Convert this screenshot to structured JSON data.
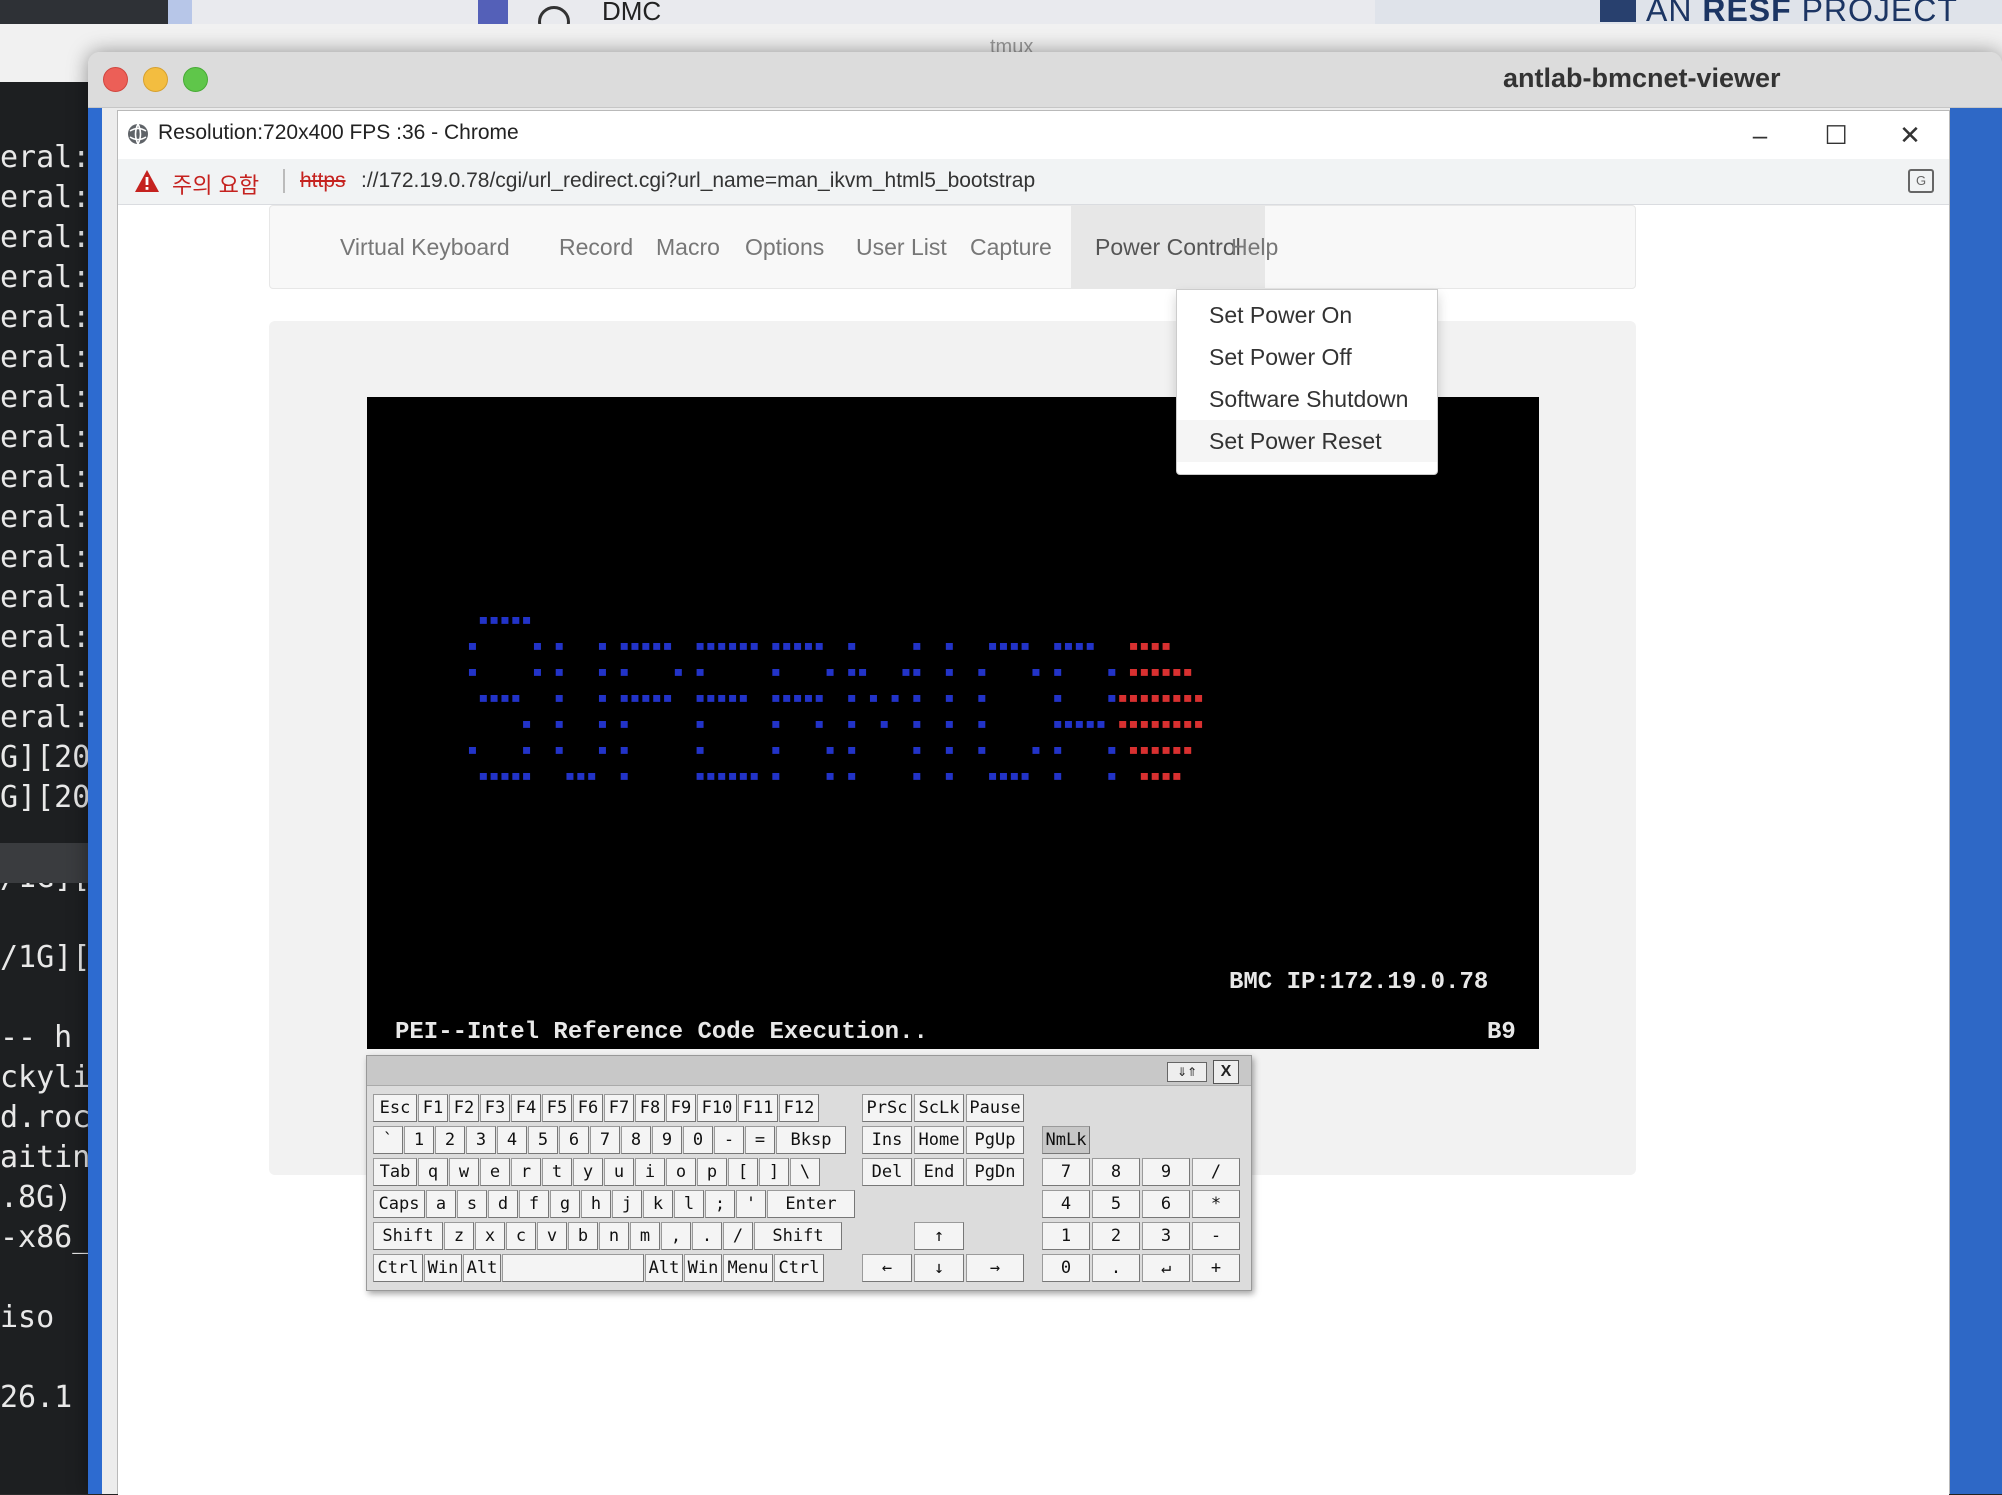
{
  "background": {
    "browser_tab_text": "DMC",
    "brand_text_prefix": "AN ",
    "brand_text_bold": "RESF",
    "brand_text_suffix": " PROJECT",
    "tmux_title": "tmux",
    "terminal_lines": [
      "eral:",
      "eral:",
      "eral:",
      "eral:",
      "eral:",
      "eral:",
      "eral:",
      "eral:",
      "eral:",
      "eral:",
      "eral:",
      "eral:",
      "eral:",
      "eral:",
      "eral:",
      "G][20",
      "G][20",
      "",
      "/1G][",
      "",
      "/1G][",
      "",
      "--  h",
      "ckyli",
      "d.roc",
      "aitin",
      ".8G)",
      "-x86_",
      "",
      "iso",
      "",
      "26.1"
    ]
  },
  "window": {
    "title": "antlab-bmcnet-viewer"
  },
  "chrome": {
    "title": "Resolution:720x400 FPS :36 - Chrome",
    "warning_text": "주의 요함",
    "url_scheme": "https",
    "url_rest": "://172.19.0.78/cgi/url_redirect.cgi?url_name=man_ikvm_html5_bootstrap",
    "controls": {
      "minimize": "–",
      "maximize": "☐",
      "close": "✕"
    }
  },
  "navbar": {
    "items": [
      "Virtual Keyboard",
      "Record",
      "Macro",
      "Options",
      "User List",
      "Capture",
      "Power Control",
      "Help"
    ],
    "active": "Power Control"
  },
  "power_menu": {
    "items": [
      "Set Power On",
      "Set Power Off",
      "Software Shutdown",
      "Set Power Reset"
    ],
    "highlighted": "Set Power Reset"
  },
  "kvm_screen": {
    "bmc_ip_text": "BMC IP:172.19.0.78",
    "status_text": "PEI--Intel Reference Code Execution..",
    "post_code": "B9"
  },
  "virtual_keyboard": {
    "mode_toggle": "⇓⇑",
    "close": "X",
    "rows": [
      [
        "Esc",
        "F1",
        "F2",
        "F3",
        "F4",
        "F5",
        "F6",
        "F7",
        "F8",
        "F9",
        "F10",
        "F11",
        "F12"
      ],
      [
        "`",
        "1",
        "2",
        "3",
        "4",
        "5",
        "6",
        "7",
        "8",
        "9",
        "0",
        "-",
        "=",
        "Bksp"
      ],
      [
        "Tab",
        "q",
        "w",
        "e",
        "r",
        "t",
        "y",
        "u",
        "i",
        "o",
        "p",
        "[",
        "]",
        "\\"
      ],
      [
        "Caps",
        "a",
        "s",
        "d",
        "f",
        "g",
        "h",
        "j",
        "k",
        "l",
        ";",
        "'",
        "Enter"
      ],
      [
        "Shift",
        "z",
        "x",
        "c",
        "v",
        "b",
        "n",
        "m",
        ",",
        ".",
        "/",
        "Shift"
      ],
      [
        "Ctrl",
        "Win",
        "Alt",
        "",
        "Alt",
        "Win",
        "Menu",
        "Ctrl"
      ]
    ],
    "nav_rows": [
      [
        "PrSc",
        "ScLk",
        "Pause"
      ],
      [
        "Ins",
        "Home",
        "PgUp"
      ],
      [
        "Del",
        "End",
        "PgDn"
      ],
      [],
      [
        "↑"
      ],
      [
        "←",
        "↓",
        "→"
      ]
    ],
    "numpad_rows": [
      [
        "NmLk"
      ],
      [
        "7",
        "8",
        "9",
        "/"
      ],
      [
        "4",
        "5",
        "6",
        "*"
      ],
      [
        "1",
        "2",
        "3",
        "-"
      ],
      [
        "0",
        ".",
        "↵",
        "+"
      ]
    ]
  },
  "colors": {
    "window_accent_blue": "#2e68c6",
    "warning_red": "#c5221f",
    "logo_blue": "#2233c8",
    "logo_red": "#d83030"
  }
}
